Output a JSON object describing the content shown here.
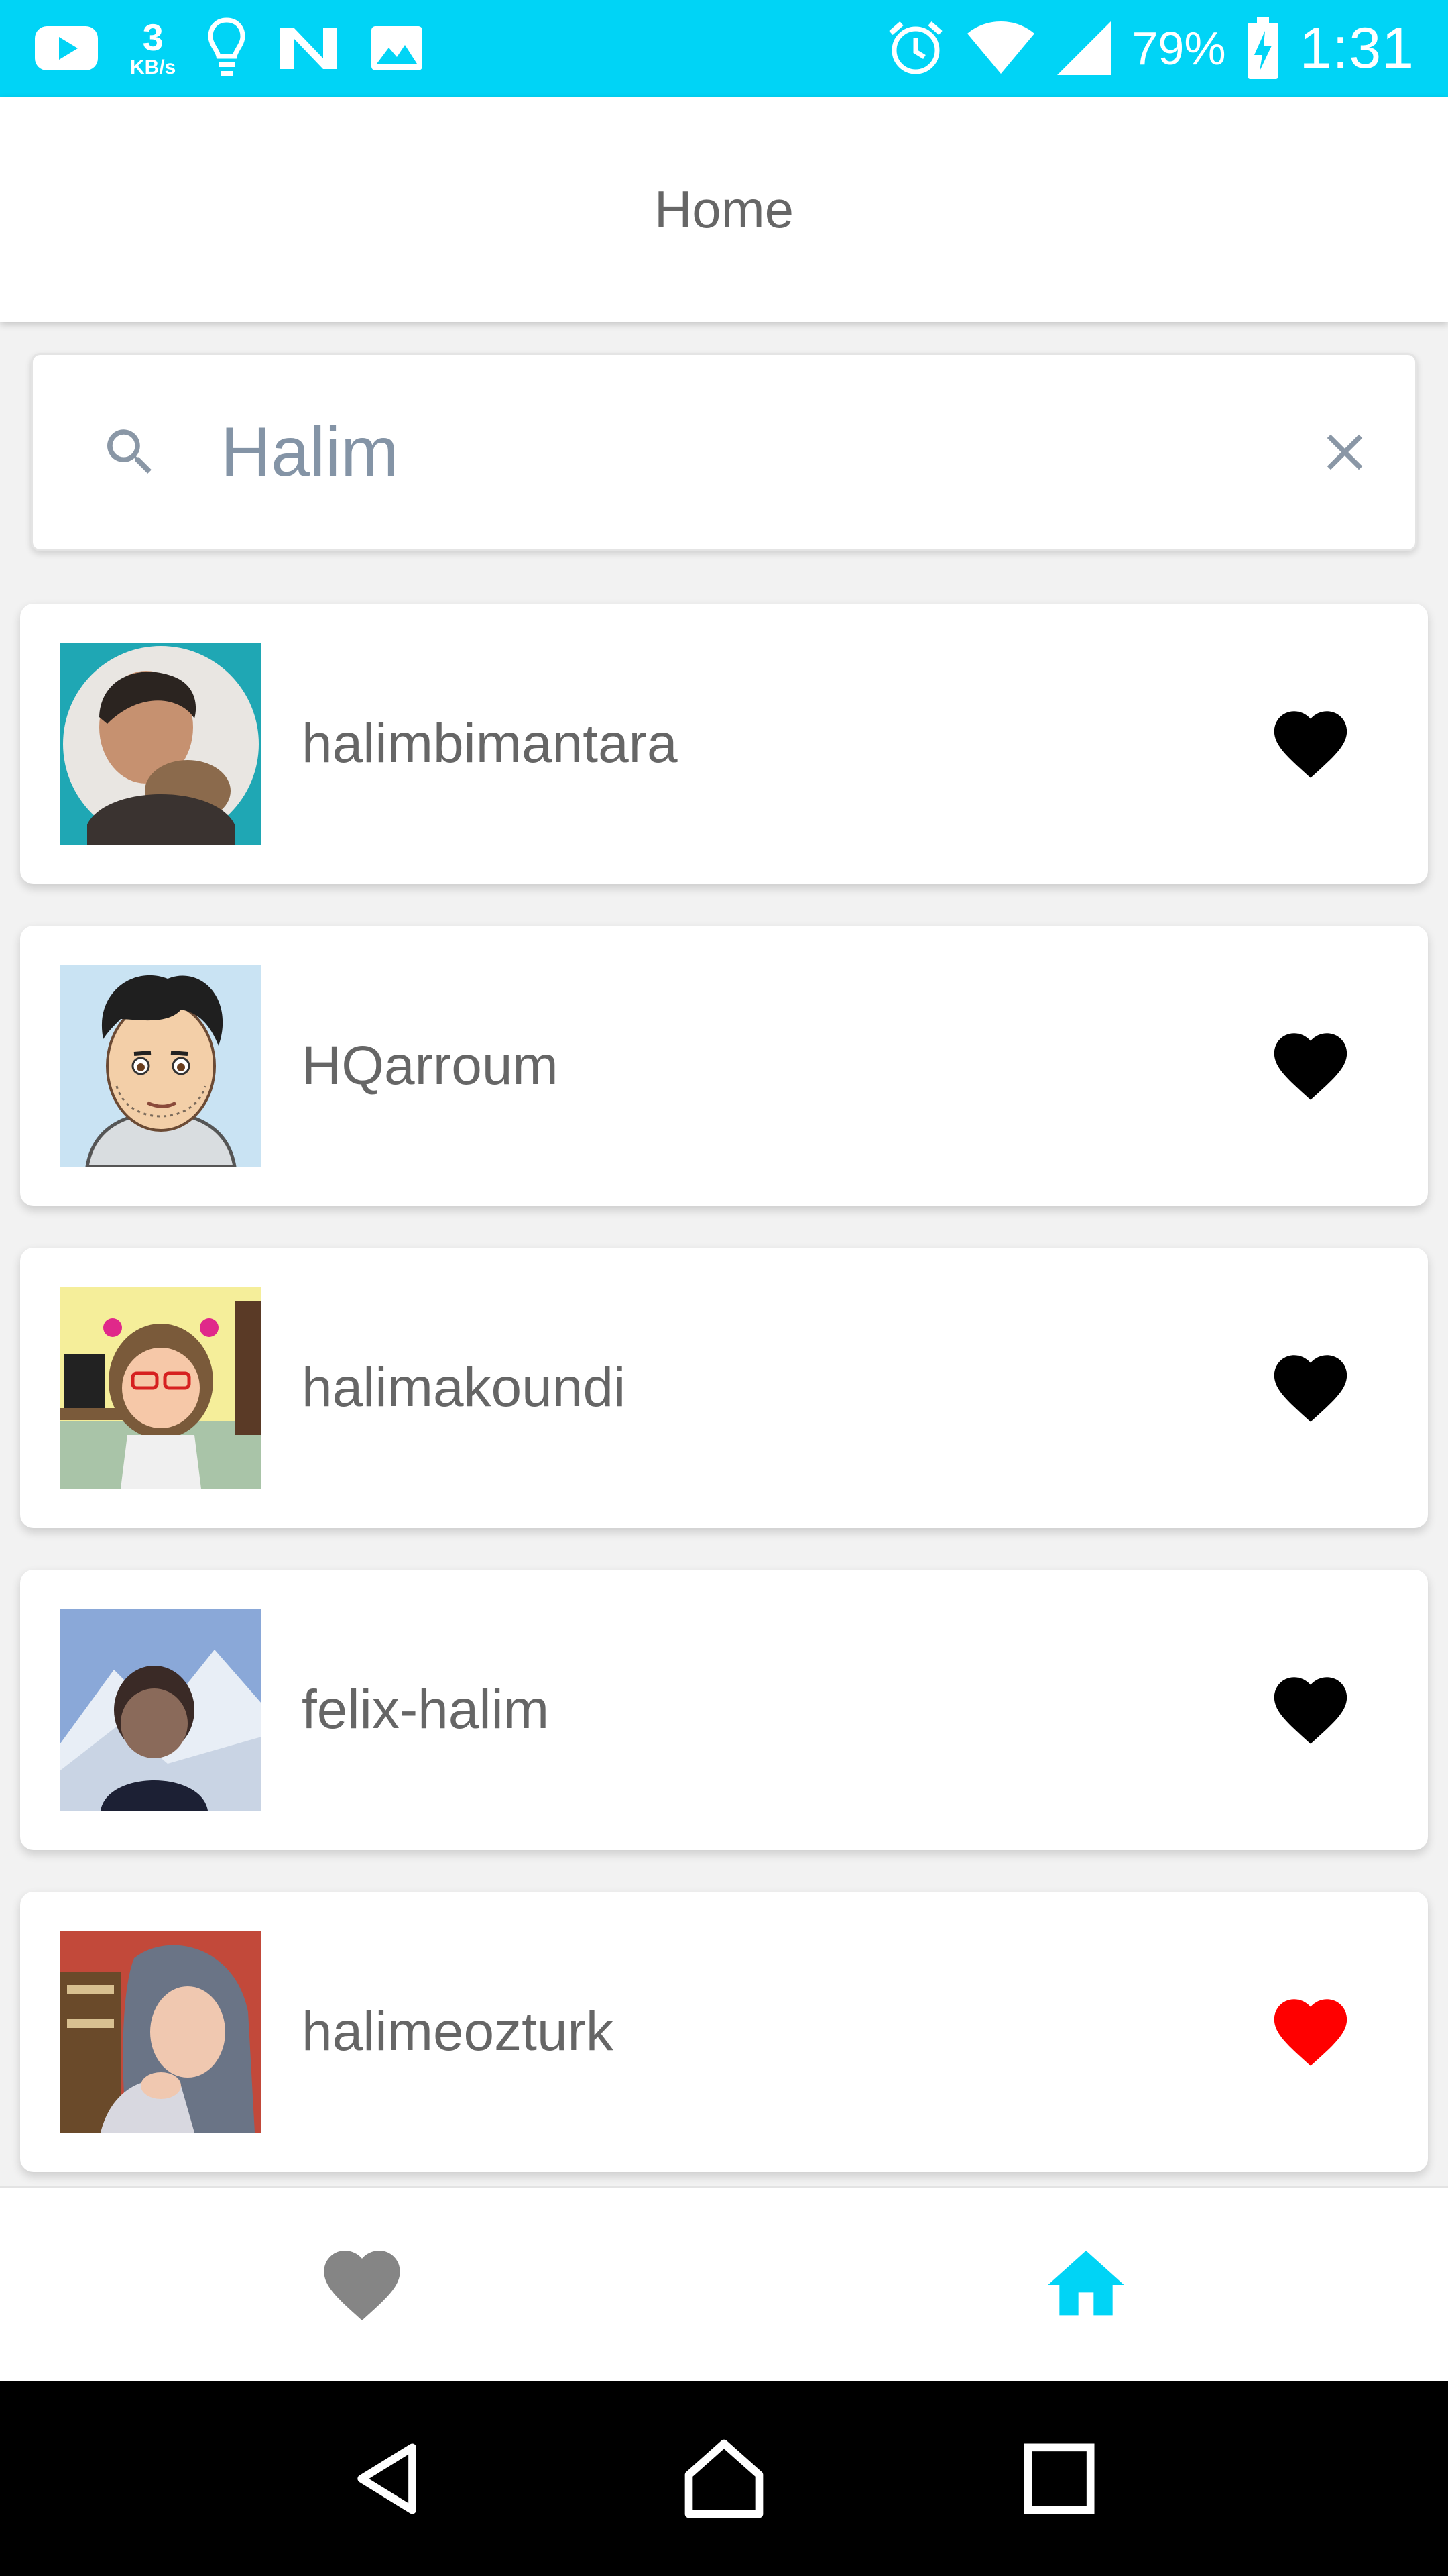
{
  "status_bar": {
    "speed_value": "3",
    "speed_unit": "KB/s",
    "battery_percent": "79%",
    "time": "1:31",
    "icons": [
      "youtube-icon",
      "lightbulb-icon",
      "n-app-icon",
      "image-icon",
      "alarm-icon",
      "wifi-icon",
      "signal-icon",
      "battery-charging-icon"
    ]
  },
  "app_bar": {
    "title": "Home"
  },
  "search": {
    "value": "Halim",
    "placeholder": ""
  },
  "users": [
    {
      "username": "halimbimantara",
      "favorite": false
    },
    {
      "username": "HQarroum",
      "favorite": false
    },
    {
      "username": "halimakoundi",
      "favorite": false
    },
    {
      "username": "felix-halim",
      "favorite": false
    },
    {
      "username": "halimeozturk",
      "favorite": true
    }
  ],
  "bottom_nav": {
    "items": [
      {
        "icon": "heart-icon",
        "active": false
      },
      {
        "icon": "home-icon",
        "active": true
      }
    ]
  },
  "system_nav": {
    "icons": [
      "back-icon",
      "home-icon",
      "recents-icon"
    ]
  },
  "colors": {
    "accent": "#00d4f6",
    "favorite_active": "#ff0000",
    "favorite_inactive": "#000000",
    "nav_inactive": "#858585"
  }
}
